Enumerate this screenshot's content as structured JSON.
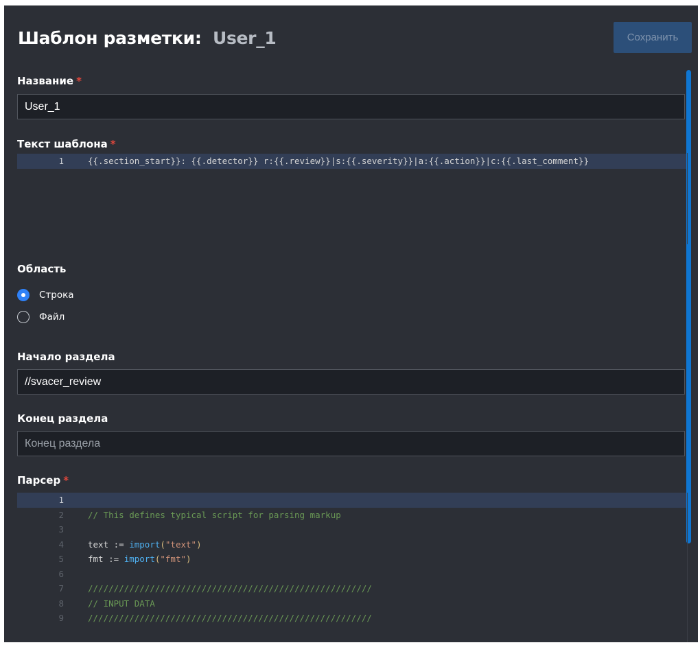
{
  "header": {
    "title_prefix": "Шаблон разметки:",
    "title_name": "User_1",
    "save_label": "Сохранить"
  },
  "form": {
    "name": {
      "label": "Название",
      "required_mark": "*",
      "value": "User_1"
    },
    "template": {
      "label": "Текст шаблона",
      "required_mark": "*",
      "lines": [
        {
          "number": "1",
          "text": "{{.section_start}}: {{.detector}} r:{{.review}}|s:{{.severity}}|a:{{.action}}|c:{{.last_comment}}"
        }
      ]
    },
    "scope": {
      "label": "Область",
      "options": [
        {
          "label": "Строка",
          "checked": true
        },
        {
          "label": "Файл",
          "checked": false
        }
      ]
    },
    "section_start": {
      "label": "Начало раздела",
      "value": "//svacer_review"
    },
    "section_end": {
      "label": "Конец раздела",
      "placeholder": "Конец раздела",
      "value": ""
    },
    "parser": {
      "label": "Парсер",
      "required_mark": "*",
      "lines": [
        {
          "number": "1",
          "tokens": []
        },
        {
          "number": "2",
          "tokens": [
            {
              "t": "// This defines typical script for parsing markup",
              "k": "comment"
            }
          ]
        },
        {
          "number": "3",
          "tokens": []
        },
        {
          "number": "4",
          "tokens": [
            {
              "t": "text := ",
              "k": "plain"
            },
            {
              "t": "import",
              "k": "fn"
            },
            {
              "t": "(",
              "k": "paren"
            },
            {
              "t": "\"text\"",
              "k": "string"
            },
            {
              "t": ")",
              "k": "paren"
            }
          ]
        },
        {
          "number": "5",
          "tokens": [
            {
              "t": "fmt := ",
              "k": "plain"
            },
            {
              "t": "import",
              "k": "fn"
            },
            {
              "t": "(",
              "k": "paren"
            },
            {
              "t": "\"fmt\"",
              "k": "string"
            },
            {
              "t": ")",
              "k": "paren"
            }
          ]
        },
        {
          "number": "6",
          "tokens": []
        },
        {
          "number": "7",
          "tokens": [
            {
              "t": "///////////////////////////////////////////////////////",
              "k": "comment"
            }
          ]
        },
        {
          "number": "8",
          "tokens": [
            {
              "t": "// INPUT DATA",
              "k": "comment"
            }
          ]
        },
        {
          "number": "9",
          "tokens": [
            {
              "t": "///////////////////////////////////////////////////////",
              "k": "comment"
            }
          ]
        }
      ]
    }
  },
  "colors": {
    "panel_bg": "#2c2f36",
    "input_bg": "#1d2026",
    "accent": "#2f81f7",
    "save_button_bg": "#2c4f79",
    "scrollbar": "#0f76d2",
    "required": "#e0473c",
    "comment": "#6a9955",
    "keyword_fn": "#4fb0f0",
    "string": "#ce9178"
  }
}
